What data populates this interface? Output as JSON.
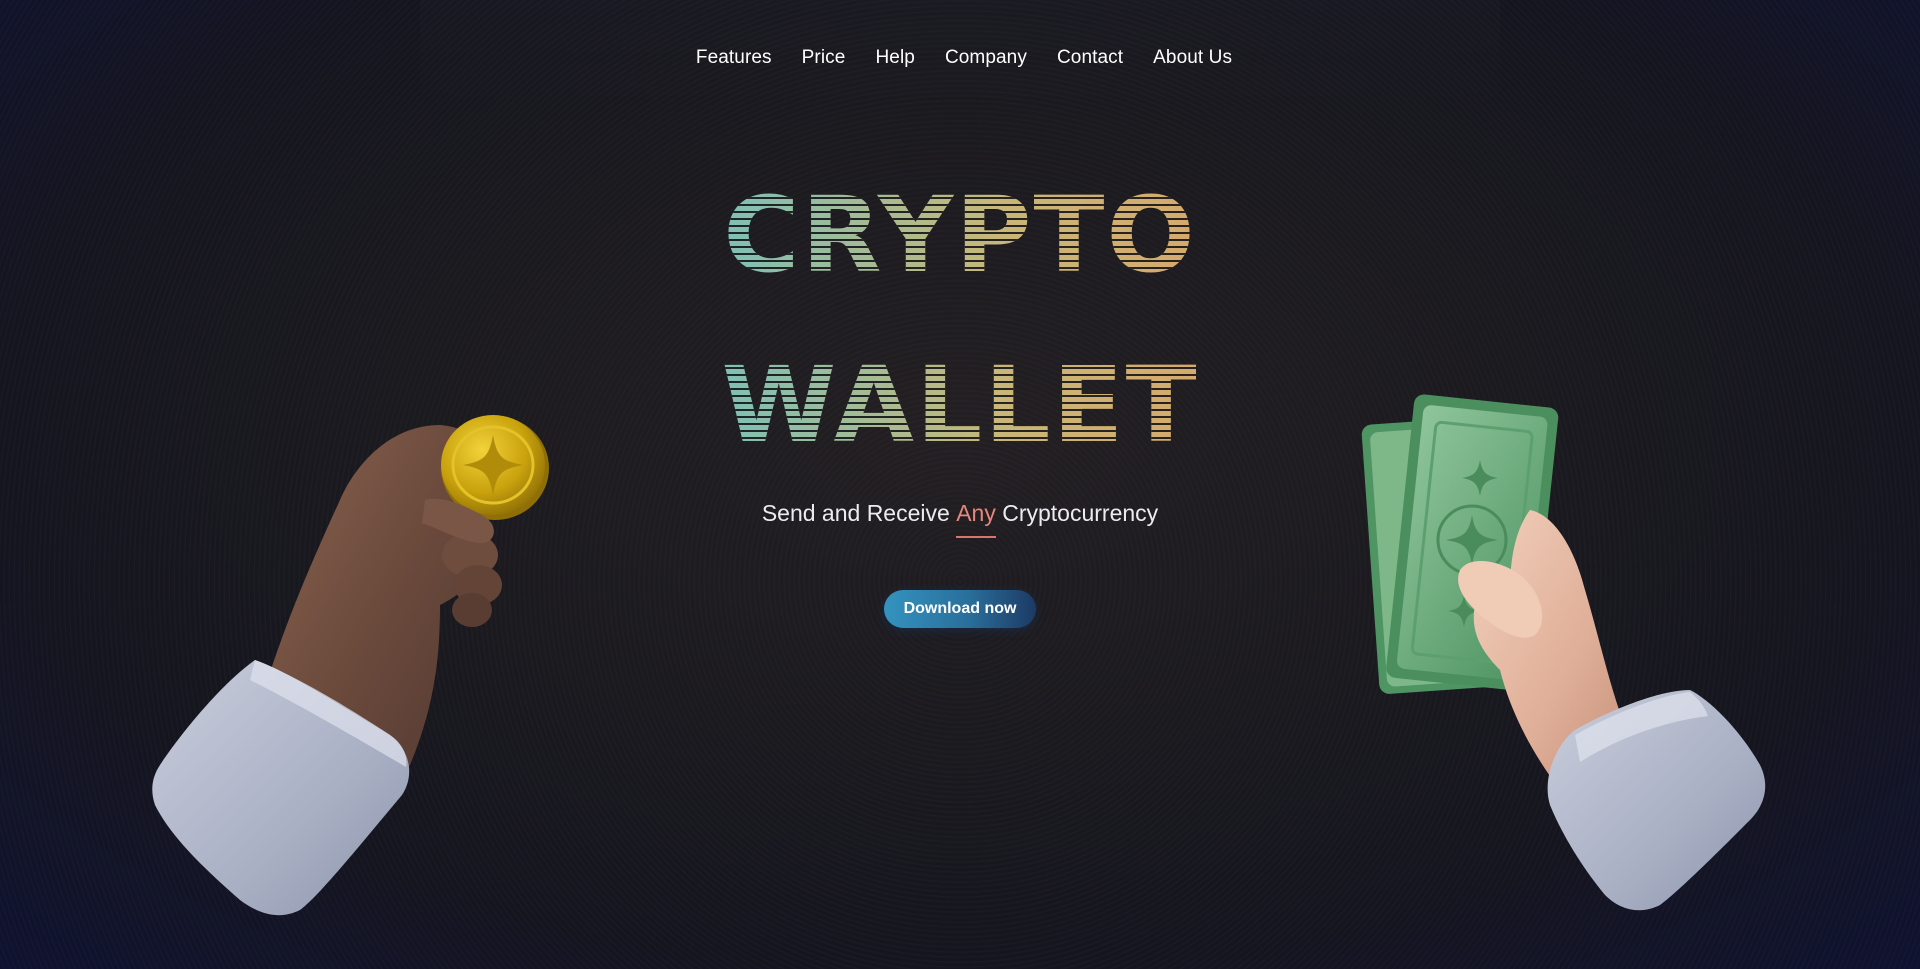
{
  "nav": {
    "items": [
      {
        "label": "Features"
      },
      {
        "label": "Price"
      },
      {
        "label": "Help"
      },
      {
        "label": "Company"
      },
      {
        "label": "Contact"
      },
      {
        "label": "About Us"
      }
    ]
  },
  "hero": {
    "title_line1": "CRYPTO",
    "title_line2": "WALLET",
    "tagline_before": "Send and Receive ",
    "tagline_highlight": "Any",
    "tagline_after": " Cryptocurrency",
    "cta_label": "Download now"
  },
  "illustrations": {
    "left": "hand-holding-coin-icon",
    "right": "hand-holding-cash-icon"
  },
  "colors": {
    "background": "#1b1a1f",
    "accent_highlight": "#e8857c",
    "cta_start": "#3493bf",
    "cta_end": "#1c3a64",
    "title_gradient_start": "#2b8cc2",
    "title_gradient_end": "#d98b54"
  }
}
